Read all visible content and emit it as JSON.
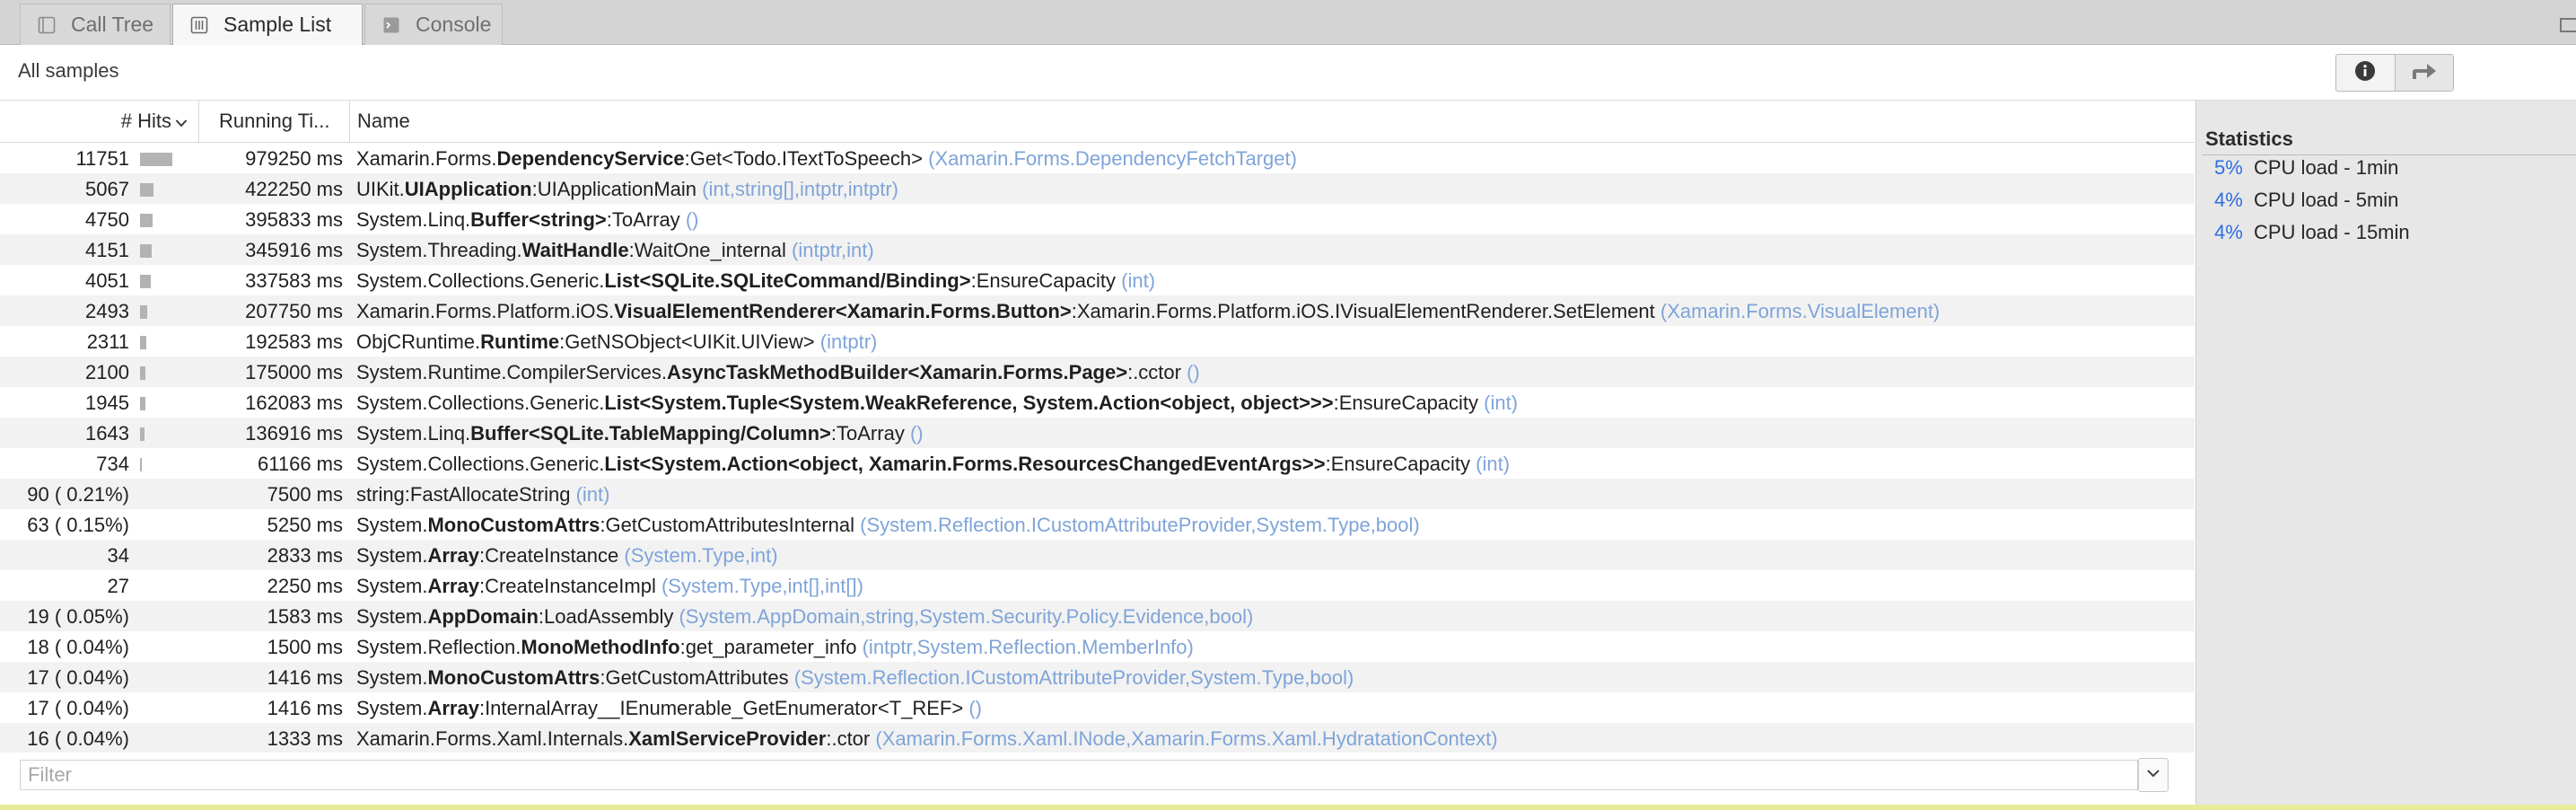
{
  "tabs": [
    {
      "label": "Call Tree",
      "icon": "call-tree-icon",
      "active": false
    },
    {
      "label": "Sample List",
      "icon": "sample-list-icon",
      "active": true
    },
    {
      "label": "Console",
      "icon": "console-icon",
      "active": false
    }
  ],
  "header": {
    "title": "All samples",
    "buttons": [
      {
        "icon": "info-icon"
      },
      {
        "icon": "forward-arrow-icon"
      }
    ]
  },
  "columns": {
    "hits": "# Hits",
    "running_time": "Running Ti...",
    "name": "Name"
  },
  "rows": [
    {
      "hits": "11751",
      "bar": 1.0,
      "time": "979250 ms",
      "prefix": "Xamarin.Forms.",
      "bold": "DependencyService",
      "member": ":Get<Todo.ITextToSpeech>",
      "params": "(Xamarin.Forms.DependencyFetchTarget)"
    },
    {
      "hits": "5067",
      "bar": 0.43,
      "time": "422250 ms",
      "prefix": "UIKit.",
      "bold": "UIApplication",
      "member": ":UIApplicationMain",
      "params": "(int,string[],intptr,intptr)"
    },
    {
      "hits": "4750",
      "bar": 0.4,
      "time": "395833 ms",
      "prefix": "System.Linq.",
      "bold": "Buffer<string>",
      "member": ":ToArray",
      "params": "()"
    },
    {
      "hits": "4151",
      "bar": 0.35,
      "time": "345916 ms",
      "prefix": "System.Threading.",
      "bold": "WaitHandle",
      "member": ":WaitOne_internal",
      "params": "(intptr,int)"
    },
    {
      "hits": "4051",
      "bar": 0.34,
      "time": "337583 ms",
      "prefix": "System.Collections.Generic.",
      "bold": "List<SQLite.SQLiteCommand/Binding>",
      "member": ":EnsureCapacity",
      "params": "(int)"
    },
    {
      "hits": "2493",
      "bar": 0.21,
      "time": "207750 ms",
      "prefix": "Xamarin.Forms.Platform.iOS.",
      "bold": "VisualElementRenderer<Xamarin.Forms.Button>",
      "member": ":Xamarin.Forms.Platform.iOS.IVisualElementRenderer.SetElement",
      "params": "(Xamarin.Forms.VisualElement)"
    },
    {
      "hits": "2311",
      "bar": 0.2,
      "time": "192583 ms",
      "prefix": "ObjCRuntime.",
      "bold": "Runtime",
      "member": ":GetNSObject<UIKit.UIView>",
      "params": "(intptr)"
    },
    {
      "hits": "2100",
      "bar": 0.18,
      "time": "175000 ms",
      "prefix": "System.Runtime.CompilerServices.",
      "bold": "AsyncTaskMethodBuilder<Xamarin.Forms.Page>",
      "member": ":.cctor",
      "params": "()"
    },
    {
      "hits": "1945",
      "bar": 0.17,
      "time": "162083 ms",
      "prefix": "System.Collections.Generic.",
      "bold": "List<System.Tuple<System.WeakReference, System.Action<object, object>>>",
      "member": ":EnsureCapacity",
      "params": "(int)"
    },
    {
      "hits": "1643",
      "bar": 0.14,
      "time": "136916 ms",
      "prefix": "System.Linq.",
      "bold": "Buffer<SQLite.TableMapping/Column>",
      "member": ":ToArray",
      "params": "()"
    },
    {
      "hits": "734",
      "bar": 0.06,
      "time": "61166 ms",
      "prefix": "System.Collections.Generic.",
      "bold": "List<System.Action<object, Xamarin.Forms.ResourcesChangedEventArgs>>",
      "member": ":EnsureCapacity",
      "params": "(int)"
    },
    {
      "hits": "90 ( 0.21%)",
      "bar": 0,
      "time": "7500 ms",
      "prefix": "",
      "bold": "",
      "member": "string:FastAllocateString",
      "params": "(int)"
    },
    {
      "hits": "63 ( 0.15%)",
      "bar": 0,
      "time": "5250 ms",
      "prefix": "System.",
      "bold": "MonoCustomAttrs",
      "member": ":GetCustomAttributesInternal",
      "params": "(System.Reflection.ICustomAttributeProvider,System.Type,bool)"
    },
    {
      "hits": "34",
      "bar": 0,
      "time": "2833 ms",
      "prefix": "System.",
      "bold": "Array",
      "member": ":CreateInstance",
      "params": "(System.Type,int)"
    },
    {
      "hits": "27",
      "bar": 0,
      "time": "2250 ms",
      "prefix": "System.",
      "bold": "Array",
      "member": ":CreateInstanceImpl",
      "params": "(System.Type,int[],int[])"
    },
    {
      "hits": "19 ( 0.05%)",
      "bar": 0,
      "time": "1583 ms",
      "prefix": "System.",
      "bold": "AppDomain",
      "member": ":LoadAssembly",
      "params": "(System.AppDomain,string,System.Security.Policy.Evidence,bool)"
    },
    {
      "hits": "18 ( 0.04%)",
      "bar": 0,
      "time": "1500 ms",
      "prefix": "System.Reflection.",
      "bold": "MonoMethodInfo",
      "member": ":get_parameter_info",
      "params": "(intptr,System.Reflection.MemberInfo)"
    },
    {
      "hits": "17 ( 0.04%)",
      "bar": 0,
      "time": "1416 ms",
      "prefix": "System.",
      "bold": "MonoCustomAttrs",
      "member": ":GetCustomAttributes",
      "params": "(System.Reflection.ICustomAttributeProvider,System.Type,bool)"
    },
    {
      "hits": "17 ( 0.04%)",
      "bar": 0,
      "time": "1416 ms",
      "prefix": "System.",
      "bold": "Array",
      "member": ":InternalArray__IEnumerable_GetEnumerator<T_REF>",
      "params": "()"
    },
    {
      "hits": "16 ( 0.04%)",
      "bar": 0,
      "time": "1333 ms",
      "prefix": "Xamarin.Forms.Xaml.Internals.",
      "bold": "XamlServiceProvider",
      "member": ":.ctor",
      "params": "(Xamarin.Forms.Xaml.INode,Xamarin.Forms.Xaml.HydratationContext)"
    }
  ],
  "filter": {
    "placeholder": "Filter",
    "value": ""
  },
  "statistics": {
    "title": "Statistics",
    "items": [
      {
        "pct": "5%",
        "label": "CPU load - 1min"
      },
      {
        "pct": "4%",
        "label": "CPU load - 5min"
      },
      {
        "pct": "4%",
        "label": "CPU load - 15min"
      }
    ]
  },
  "colors": {
    "accent": "#2f6fe0",
    "params": "#7fa4d8",
    "bar": "#b3b3b3"
  }
}
